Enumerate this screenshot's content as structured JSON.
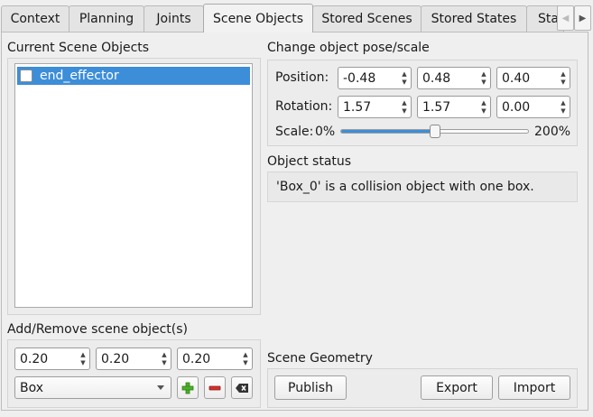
{
  "tabs": [
    {
      "label": "Context"
    },
    {
      "label": "Planning"
    },
    {
      "label": "Joints"
    },
    {
      "label": "Scene Objects"
    },
    {
      "label": "Stored Scenes"
    },
    {
      "label": "Stored States"
    },
    {
      "label": "Stat"
    }
  ],
  "scene_objects": {
    "title": "Current Scene Objects",
    "items": [
      {
        "name": "end_effector",
        "checked": false
      }
    ]
  },
  "pose": {
    "title": "Change object pose/scale",
    "position_label": "Position:",
    "position": [
      "-0.48",
      "0.48",
      "0.40"
    ],
    "rotation_label": "Rotation:",
    "rotation": [
      "1.57",
      "1.57",
      "0.00"
    ],
    "scale_label": "Scale:",
    "scale_min": "0%",
    "scale_max": "200%",
    "scale_fraction": 0.5
  },
  "status": {
    "title": "Object status",
    "text": "'Box_0' is a collision object with one box."
  },
  "add_remove": {
    "title": "Add/Remove scene object(s)",
    "dims": [
      "0.20",
      "0.20",
      "0.20"
    ],
    "shape": "Box"
  },
  "geometry": {
    "title": "Scene Geometry",
    "publish": "Publish",
    "export": "Export",
    "import": "Import"
  },
  "colors": {
    "accent": "#3d8ed8",
    "add": "#4caf2a",
    "remove": "#d0312d"
  }
}
